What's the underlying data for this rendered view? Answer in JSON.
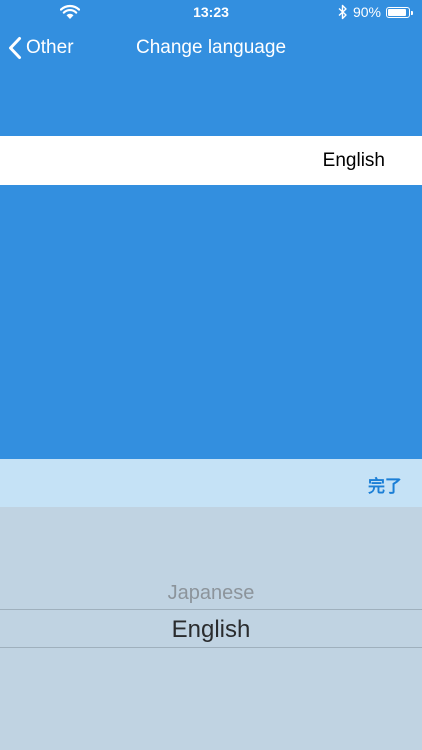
{
  "status_bar": {
    "time": "13:23",
    "battery_percent": "90%",
    "battery_level": 0.9
  },
  "nav": {
    "back_label": "Other",
    "title": "Change language"
  },
  "language_row": {
    "value": "English"
  },
  "picker_toolbar": {
    "done_label": "完了"
  },
  "picker": {
    "options": [
      "Japanese",
      "English"
    ],
    "selected": "English"
  },
  "colors": {
    "background": "#338fdf",
    "toolbar": "#c5e2f6",
    "picker": "#c0d3e2",
    "done_text": "#1b7fd6"
  }
}
